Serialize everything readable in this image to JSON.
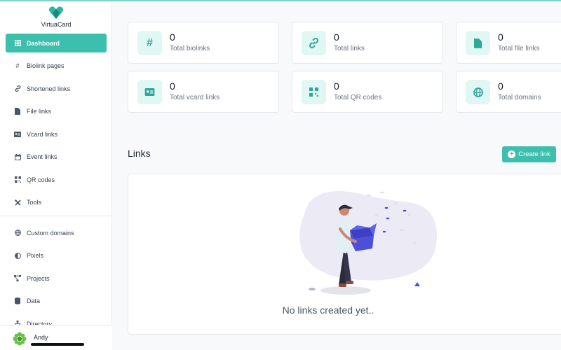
{
  "brand": {
    "name": "VirtuaCard"
  },
  "sidebar": {
    "items": [
      {
        "label": "Dashboard",
        "icon": "grid-icon",
        "active": true
      },
      {
        "label": "Biolink pages",
        "icon": "hash-icon"
      },
      {
        "label": "Shortened links",
        "icon": "link-icon"
      },
      {
        "label": "File links",
        "icon": "file-icon"
      },
      {
        "label": "Vcard links",
        "icon": "id-card-icon"
      },
      {
        "label": "Event links",
        "icon": "calendar-icon"
      },
      {
        "label": "QR codes",
        "icon": "qr-icon"
      },
      {
        "label": "Tools",
        "icon": "tools-icon"
      }
    ],
    "items2": [
      {
        "label": "Custom domains",
        "icon": "globe-icon"
      },
      {
        "label": "Pixels",
        "icon": "adjust-icon"
      },
      {
        "label": "Projects",
        "icon": "project-diagram-icon"
      },
      {
        "label": "Data",
        "icon": "database-icon"
      },
      {
        "label": "Directory",
        "icon": "sitemap-icon"
      }
    ]
  },
  "user": {
    "name": "Andy"
  },
  "stats": [
    {
      "value": "0",
      "label": "Total biolinks",
      "icon": "hash-icon"
    },
    {
      "value": "0",
      "label": "Total links",
      "icon": "link-icon"
    },
    {
      "value": "0",
      "label": "Total file links",
      "icon": "file-icon"
    },
    {
      "value": "0",
      "label": "Total vcard links",
      "icon": "id-card-icon"
    },
    {
      "value": "0",
      "label": "Total QR codes",
      "icon": "qr-icon"
    },
    {
      "value": "0",
      "label": "Total domains",
      "icon": "globe-icon"
    }
  ],
  "links": {
    "title": "Links",
    "create_label": "Create link",
    "empty_text": "No links created yet.."
  },
  "colors": {
    "accent": "#3dbfad",
    "icon_bg": "#e0f7f3",
    "illustration_blue": "#4c4fd8"
  }
}
